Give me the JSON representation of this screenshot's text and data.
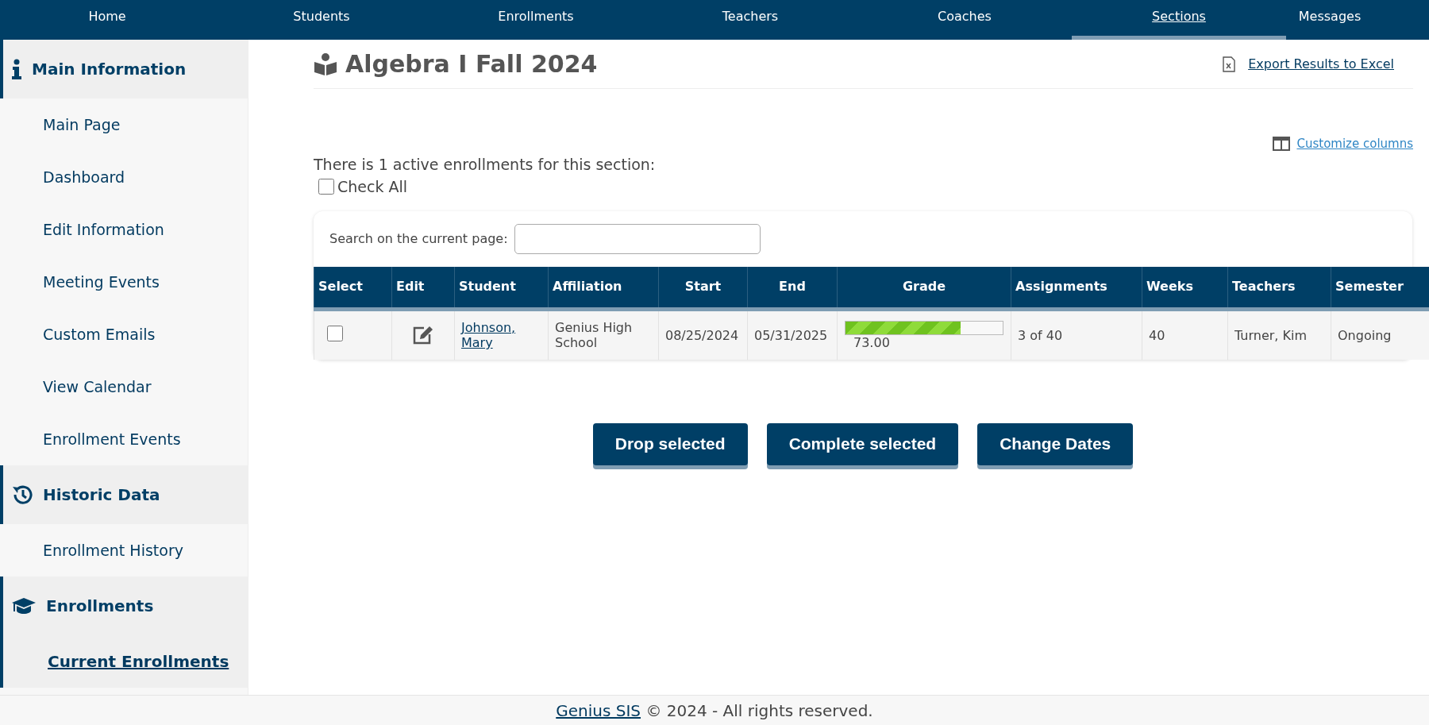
{
  "nav": [
    {
      "label": "Home",
      "selected": false
    },
    {
      "label": "Students",
      "selected": false
    },
    {
      "label": "Enrollments",
      "selected": false
    },
    {
      "label": "Teachers",
      "selected": false
    },
    {
      "label": "Coaches",
      "selected": false
    },
    {
      "label": "Sections",
      "selected": true
    },
    {
      "label": "Messages",
      "selected": false
    }
  ],
  "sidebar": [
    {
      "heading": "Main Information",
      "items": [
        {
          "label": "Main Page",
          "selected": false
        },
        {
          "label": "Dashboard",
          "selected": false
        },
        {
          "label": "Edit Information",
          "selected": false
        },
        {
          "label": "Meeting Events",
          "selected": false
        },
        {
          "label": "Custom Emails",
          "selected": false
        },
        {
          "label": "View Calendar",
          "selected": false
        },
        {
          "label": "Enrollment Events",
          "selected": false
        }
      ]
    },
    {
      "heading": "Historic Data",
      "items": [
        {
          "label": "Enrollment History",
          "selected": false
        }
      ]
    },
    {
      "heading": "Enrollments",
      "items": [
        {
          "label": "Current Enrollments",
          "selected": true
        }
      ]
    }
  ],
  "header": {
    "title": "Algebra I Fall 2024",
    "export_link": "Export Results to Excel"
  },
  "customize_link": "Customize columns",
  "summary": "There is 1 active enrollments for this section:",
  "check_all": {
    "label": "Check All",
    "checked": false
  },
  "search": {
    "label": "Search on the current page:"
  },
  "table": {
    "columns": [
      "Select",
      "Edit",
      "Student",
      "Affiliation",
      "Start",
      "End",
      "Grade",
      "Assignments",
      "Weeks",
      "Teachers",
      "Semester"
    ],
    "rows": [
      {
        "checked": false,
        "student": "Johnson, Mary",
        "affiliation": "Genius High School",
        "start": "08/25/2024",
        "end": "05/31/2025",
        "grade": {
          "level": 0.73,
          "value": "73.00"
        },
        "assignments": "3 of 40",
        "weeks": "40",
        "teachers": "Turner, Kim",
        "semester": "Ongoing"
      }
    ]
  },
  "buttons": [
    "Drop selected",
    "Complete selected",
    "Change Dates"
  ],
  "footer": {
    "link": "Genius SIS",
    "text": "© 2024 - All rights reserved."
  }
}
